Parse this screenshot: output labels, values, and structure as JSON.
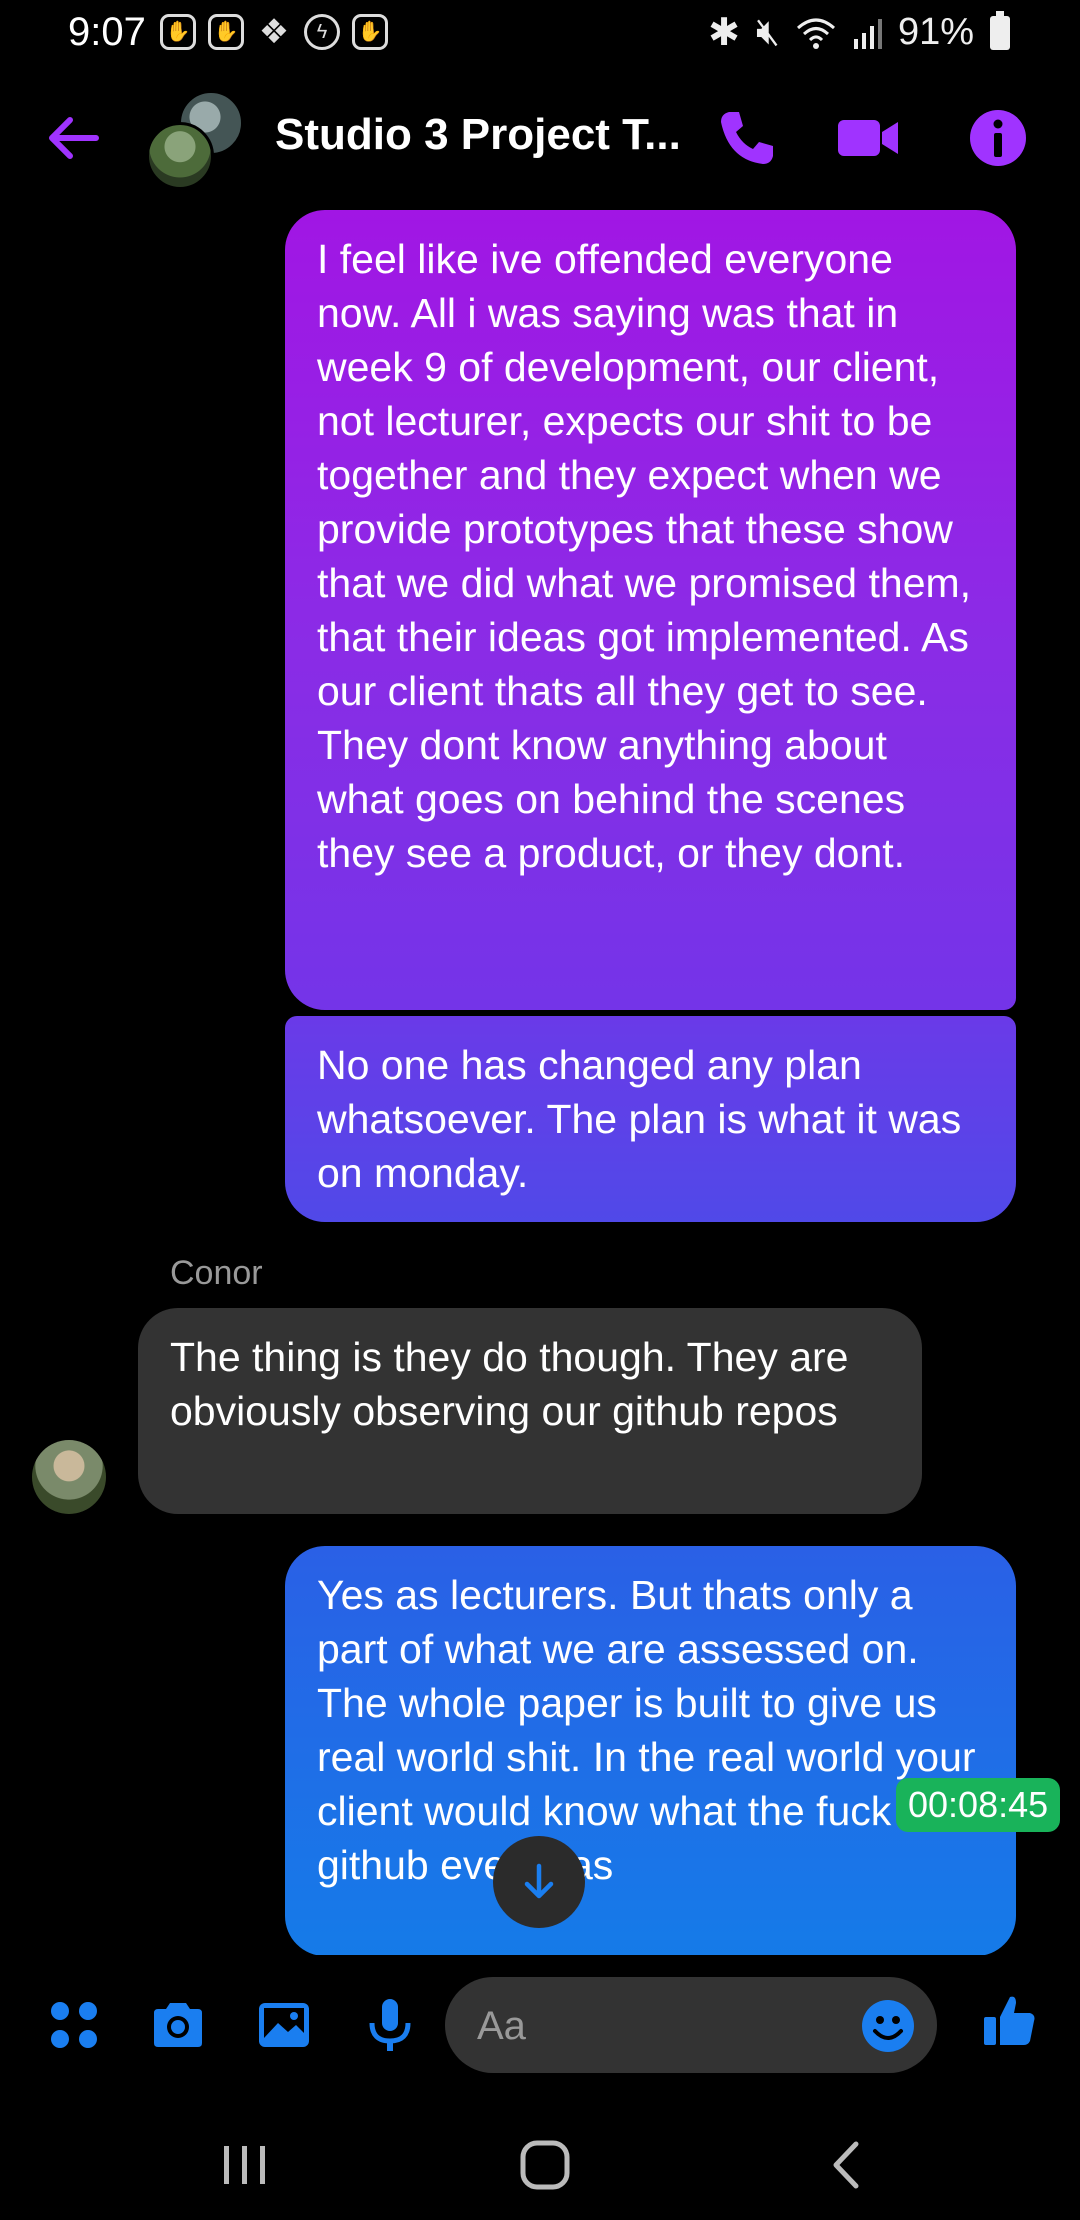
{
  "status_bar": {
    "time": "9:07",
    "battery": "91%",
    "notification_icons": [
      "hand-icon",
      "hand-icon",
      "binance-icon",
      "messenger-icon",
      "hand-icon"
    ]
  },
  "header": {
    "title": "Studio 3 Project T...",
    "accent_color": "#a033ff"
  },
  "messages": [
    {
      "direction": "outgoing",
      "text": "I feel like ive offended everyone now. All i was saying was that in week 9 of development, our client, not lecturer, expects our shit to be together and they expect when we provide prototypes that these show that we did what we promised them, that their ideas got implemented. As our client thats all they get to see. They dont know anything about what goes on behind the scenes they see a product, or they dont."
    },
    {
      "direction": "outgoing",
      "text": "No one has changed any plan whatsoever. The plan is what it was on monday."
    },
    {
      "direction": "incoming",
      "sender": "Conor",
      "text": "The thing is they do though. They are obviously observing our github repos"
    },
    {
      "direction": "outgoing",
      "text": "Yes as lecturers. But thats only a part of what we are assessed on. The whole paper is built to give us real world shit. In the real world your client would know what the fuck a github even was"
    }
  ],
  "timestamp_overlay": "00:08:45",
  "composer": {
    "placeholder": "Aa"
  },
  "colors": {
    "incoming_bubble": "#333333",
    "composer_icon": "#1a7ef0",
    "timestamp_bg": "#19b35a"
  }
}
